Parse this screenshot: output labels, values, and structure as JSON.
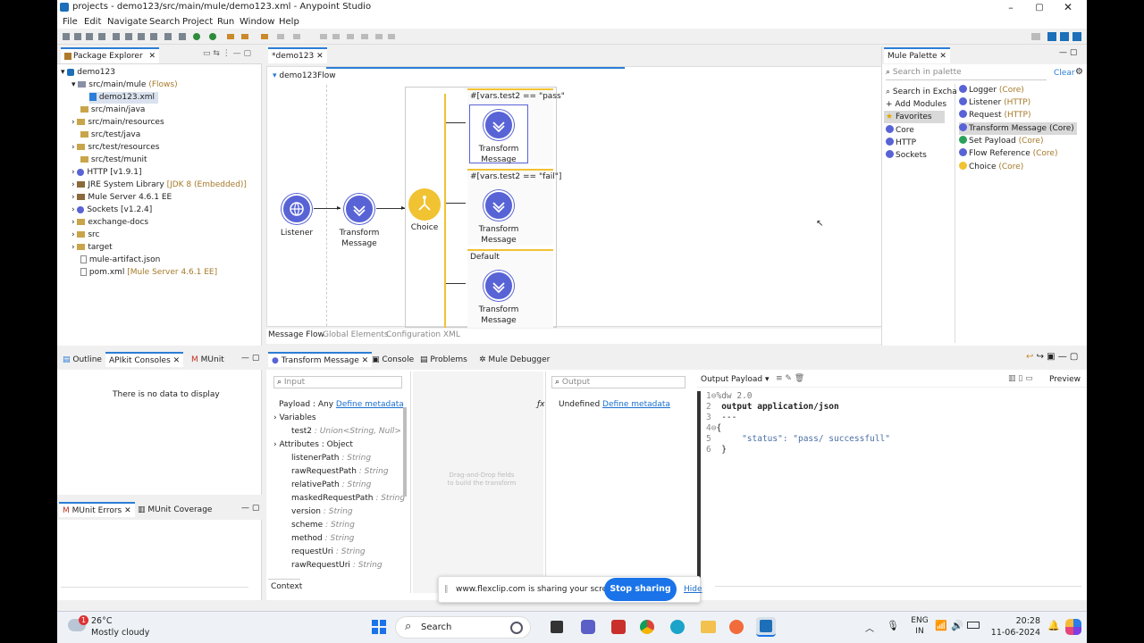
{
  "window": {
    "title": "projects - demo123/src/main/mule/demo123.xml - Anypoint Studio"
  },
  "menu": [
    "File",
    "Edit",
    "Navigate",
    "Search",
    "Project",
    "Run",
    "Window",
    "Help"
  ],
  "explorer": {
    "tab_label": "Package Explorer",
    "tree": [
      {
        "text": "demo123",
        "suffix": ""
      },
      {
        "text": "src/main/mule",
        "suffix": "(Flows)"
      },
      {
        "text": "demo123.xml",
        "suffix": ""
      },
      {
        "text": "src/main/java",
        "suffix": ""
      },
      {
        "text": "src/main/resources",
        "suffix": ""
      },
      {
        "text": "src/test/java",
        "suffix": ""
      },
      {
        "text": "src/test/resources",
        "suffix": ""
      },
      {
        "text": "src/test/munit",
        "suffix": ""
      },
      {
        "text": "HTTP [v1.9.1]",
        "suffix": ""
      },
      {
        "text": "JRE System Library",
        "suffix": "[JDK 8 (Embedded)]"
      },
      {
        "text": "Mule Server 4.6.1 EE",
        "suffix": ""
      },
      {
        "text": "Sockets [v1.2.4]",
        "suffix": ""
      },
      {
        "text": "exchange-docs",
        "suffix": ""
      },
      {
        "text": "src",
        "suffix": ""
      },
      {
        "text": "target",
        "suffix": ""
      },
      {
        "text": "mule-artifact.json",
        "suffix": ""
      },
      {
        "text": "pom.xml",
        "suffix": "[Mule Server 4.6.1 EE]"
      }
    ]
  },
  "editor": {
    "tab_label": "*demo123",
    "flow_name": "demo123Flow",
    "listener_label": "Listener",
    "transform1_line1": "Transform",
    "transform1_line2": "Message",
    "choice_label": "Choice",
    "route1_cond": "#[vars.test2 == \"pass\"",
    "route2_cond": "#[vars.test2 == \"fail\"]",
    "route3_cond": "Default",
    "route_line1": "Transform",
    "route_line2": "Message",
    "bottom_tabs": [
      "Message Flow",
      "Global Elements",
      "Configuration XML"
    ]
  },
  "palette": {
    "tab_label": "Mule Palette",
    "search_placeholder": "Search in palette",
    "clear_label": "Clear",
    "left_items": [
      "Search in Excha",
      "Add Modules",
      "Favorites",
      "Core",
      "HTTP",
      "Sockets"
    ],
    "right_items": [
      {
        "name": "Logger",
        "module": "(Core)",
        "color": "#5863d6"
      },
      {
        "name": "Listener",
        "module": "(HTTP)",
        "color": "#5863d6"
      },
      {
        "name": "Request",
        "module": "(HTTP)",
        "color": "#5863d6"
      },
      {
        "name": "Transform Message",
        "module": "(Core)",
        "color": "#5863d6"
      },
      {
        "name": "Set Payload",
        "module": "(Core)",
        "color": "#2aa15a"
      },
      {
        "name": "Flow Reference",
        "module": "(Core)",
        "color": "#5863d6"
      },
      {
        "name": "Choice",
        "module": "(Core)",
        "color": "#f1c232"
      }
    ]
  },
  "left_bottom": {
    "tabs": [
      "Outline",
      "APIkit Consoles",
      "MUnit"
    ],
    "empty_text": "There is no data to display",
    "tabs2": [
      "MUnit Errors",
      "MUnit Coverage"
    ]
  },
  "transform": {
    "tabs": [
      "Transform Message",
      "Console",
      "Problems",
      "Mule Debugger"
    ],
    "input_placeholder": "Input",
    "output_placeholder": "Output",
    "payload_label": "Payload : Any",
    "define_metadata": "Define metadata",
    "variables_label": "Variables",
    "test2_label": "test2",
    "test2_type": ": Union<String, Null>",
    "attributes_label": "Attributes : Object",
    "attributes": [
      {
        "name": "listenerPath",
        "type": ": String"
      },
      {
        "name": "rawRequestPath",
        "type": ": String"
      },
      {
        "name": "relativePath",
        "type": ": String"
      },
      {
        "name": "maskedRequestPath",
        "type": ": String"
      },
      {
        "name": "version",
        "type": ": String"
      },
      {
        "name": "scheme",
        "type": ": String"
      },
      {
        "name": "method",
        "type": ": String"
      },
      {
        "name": "requestUri",
        "type": ": String"
      },
      {
        "name": "rawRequestUri",
        "type": ": String"
      }
    ],
    "context_label": "Context",
    "dragdrop_line1": "Drag-and-Drop fields",
    "dragdrop_line2": "to build the transform",
    "undefined_label": "Undefined",
    "output_label": "Output",
    "payload_select": "Payload",
    "preview_label": "Preview",
    "code": [
      {
        "num": "1",
        "text": "%dw 2.0"
      },
      {
        "num": "2",
        "text": "output application/json"
      },
      {
        "num": "3",
        "text": "---"
      },
      {
        "num": "4",
        "text": "{"
      },
      {
        "num": "5",
        "text": "    \"status\": \"pass/ successfull\""
      },
      {
        "num": "6",
        "text": "}"
      }
    ]
  },
  "sharing": {
    "text": "www.flexclip.com is sharing your screen.",
    "stop_label": "Stop sharing",
    "hide_label": "Hide"
  },
  "taskbar": {
    "weather_temp": "26°C",
    "weather_desc": "Mostly cloudy",
    "weather_badge": "1",
    "search_label": "Search",
    "lang_line1": "ENG",
    "lang_line2": "IN",
    "time": "20:28",
    "date": "11-06-2024"
  }
}
